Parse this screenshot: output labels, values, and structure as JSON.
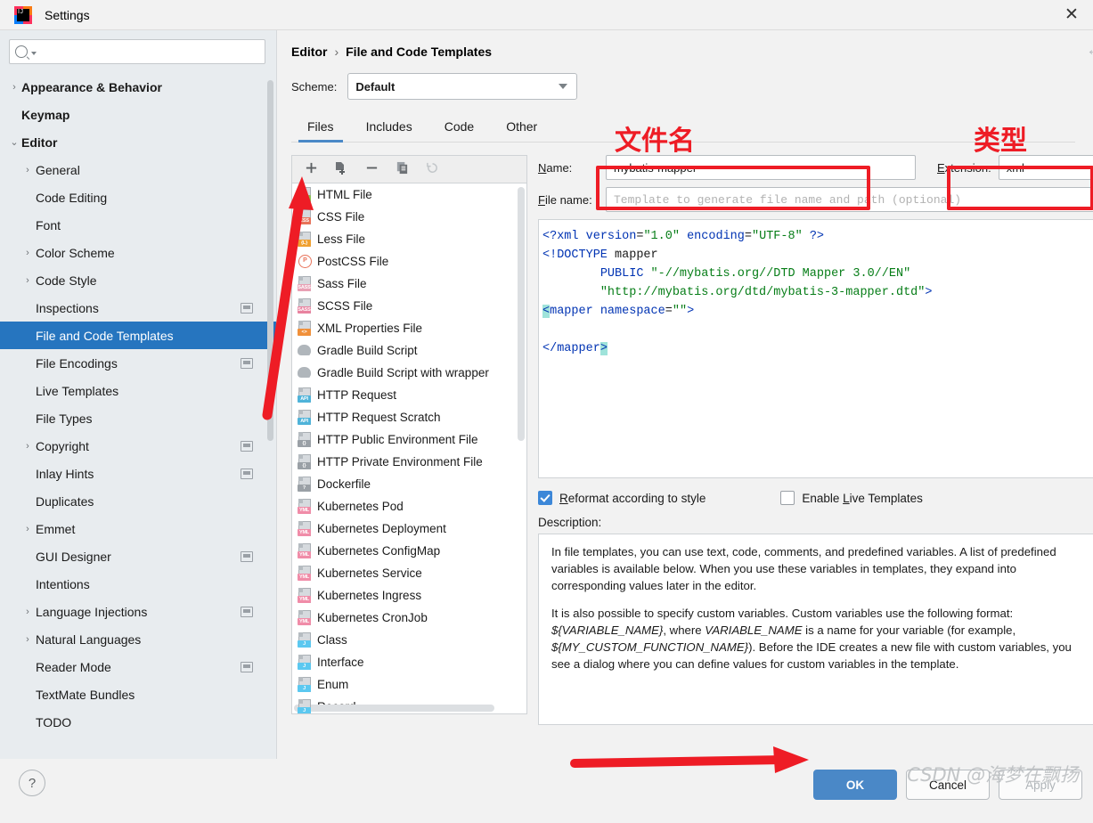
{
  "window": {
    "title": "Settings",
    "close_label": "✕",
    "logo": "intellij-idea-logo"
  },
  "search": {
    "value": "",
    "placeholder": ""
  },
  "sidebar": {
    "items": [
      {
        "label": "Appearance & Behavior",
        "level": 0,
        "arrow": "›",
        "badge": false,
        "selected": false
      },
      {
        "label": "Keymap",
        "level": 0,
        "arrow": "",
        "badge": false,
        "selected": false
      },
      {
        "label": "Editor",
        "level": 0,
        "arrow": "⌄",
        "badge": false,
        "selected": false
      },
      {
        "label": "General",
        "level": 1,
        "arrow": "›",
        "badge": false,
        "selected": false
      },
      {
        "label": "Code Editing",
        "level": 1,
        "arrow": "",
        "badge": false,
        "selected": false
      },
      {
        "label": "Font",
        "level": 1,
        "arrow": "",
        "badge": false,
        "selected": false
      },
      {
        "label": "Color Scheme",
        "level": 1,
        "arrow": "›",
        "badge": false,
        "selected": false
      },
      {
        "label": "Code Style",
        "level": 1,
        "arrow": "›",
        "badge": false,
        "selected": false
      },
      {
        "label": "Inspections",
        "level": 1,
        "arrow": "",
        "badge": true,
        "selected": false
      },
      {
        "label": "File and Code Templates",
        "level": 1,
        "arrow": "",
        "badge": false,
        "selected": true
      },
      {
        "label": "File Encodings",
        "level": 1,
        "arrow": "",
        "badge": true,
        "selected": false
      },
      {
        "label": "Live Templates",
        "level": 1,
        "arrow": "",
        "badge": false,
        "selected": false
      },
      {
        "label": "File Types",
        "level": 1,
        "arrow": "",
        "badge": false,
        "selected": false
      },
      {
        "label": "Copyright",
        "level": 1,
        "arrow": "›",
        "badge": true,
        "selected": false
      },
      {
        "label": "Inlay Hints",
        "level": 1,
        "arrow": "",
        "badge": true,
        "selected": false
      },
      {
        "label": "Duplicates",
        "level": 1,
        "arrow": "",
        "badge": false,
        "selected": false
      },
      {
        "label": "Emmet",
        "level": 1,
        "arrow": "›",
        "badge": false,
        "selected": false
      },
      {
        "label": "GUI Designer",
        "level": 1,
        "arrow": "",
        "badge": true,
        "selected": false
      },
      {
        "label": "Intentions",
        "level": 1,
        "arrow": "",
        "badge": false,
        "selected": false
      },
      {
        "label": "Language Injections",
        "level": 1,
        "arrow": "›",
        "badge": true,
        "selected": false
      },
      {
        "label": "Natural Languages",
        "level": 1,
        "arrow": "›",
        "badge": false,
        "selected": false
      },
      {
        "label": "Reader Mode",
        "level": 1,
        "arrow": "",
        "badge": true,
        "selected": false
      },
      {
        "label": "TextMate Bundles",
        "level": 1,
        "arrow": "",
        "badge": false,
        "selected": false
      },
      {
        "label": "TODO",
        "level": 1,
        "arrow": "",
        "badge": false,
        "selected": false
      }
    ]
  },
  "breadcrumb": {
    "parent": "Editor",
    "separator": "›",
    "current": "File and Code Templates"
  },
  "nav": {
    "back": "←",
    "forward": "→"
  },
  "scheme": {
    "label": "Scheme:",
    "value": "Default"
  },
  "tabs": [
    {
      "label": "Files",
      "active": true
    },
    {
      "label": "Includes",
      "active": false
    },
    {
      "label": "Code",
      "active": false
    },
    {
      "label": "Other",
      "active": false
    }
  ],
  "list_toolbar": [
    {
      "name": "add-template-button",
      "glyph": "+",
      "disabled": false
    },
    {
      "name": "create-template-from-file-button",
      "glyph": "",
      "disabled": false
    },
    {
      "name": "remove-template-button",
      "glyph": "−",
      "disabled": false
    },
    {
      "name": "copy-template-button",
      "glyph": "",
      "disabled": false
    },
    {
      "name": "reset-template-button",
      "glyph": "↺",
      "disabled": true
    }
  ],
  "templates": [
    {
      "label": "HTML File",
      "icon": "html-file-icon",
      "tag": "",
      "tagcolor": "#8cc152",
      "blob": "#8cc152"
    },
    {
      "label": "CSS File",
      "icon": "css-file-icon",
      "tag": "CSS",
      "tagcolor": "#e8735a",
      "blob": ""
    },
    {
      "label": "Less File",
      "icon": "less-file-icon",
      "tag": "{L}",
      "tagcolor": "#f0a030",
      "blob": ""
    },
    {
      "label": "PostCSS File",
      "icon": "postcss-file-icon",
      "tag": "",
      "tagcolor": "",
      "blob": ""
    },
    {
      "label": "Sass File",
      "icon": "sass-file-icon",
      "tag": "SASS",
      "tagcolor": "#e8a0b4",
      "blob": ""
    },
    {
      "label": "SCSS File",
      "icon": "scss-file-icon",
      "tag": "SASS",
      "tagcolor": "#e8829f",
      "blob": ""
    },
    {
      "label": "XML Properties File",
      "icon": "xml-properties-file-icon",
      "tag": "<>",
      "tagcolor": "#f0903a",
      "blob": ""
    },
    {
      "label": "Gradle Build Script",
      "icon": "gradle-file-icon",
      "tag": "",
      "tagcolor": "",
      "blob": ""
    },
    {
      "label": "Gradle Build Script with wrapper",
      "icon": "gradle-wrapper-file-icon",
      "tag": "",
      "tagcolor": "",
      "blob": ""
    },
    {
      "label": "HTTP Request",
      "icon": "http-request-file-icon",
      "tag": "API",
      "tagcolor": "#4fb3d9",
      "blob": ""
    },
    {
      "label": "HTTP Request Scratch",
      "icon": "http-request-scratch-icon",
      "tag": "API",
      "tagcolor": "#4fb3d9",
      "blob": ""
    },
    {
      "label": "HTTP Public Environment File",
      "icon": "http-public-env-file-icon",
      "tag": "{}",
      "tagcolor": "#9aa0a6",
      "blob": ""
    },
    {
      "label": "HTTP Private Environment File",
      "icon": "http-private-env-file-icon",
      "tag": "{}",
      "tagcolor": "#9aa0a6",
      "blob": ""
    },
    {
      "label": "Dockerfile",
      "icon": "dockerfile-icon",
      "tag": "?",
      "tagcolor": "#9aa0a6",
      "blob": ""
    },
    {
      "label": "Kubernetes Pod",
      "icon": "kubernetes-pod-icon",
      "tag": "YML",
      "tagcolor": "#f08ca8",
      "blob": ""
    },
    {
      "label": "Kubernetes Deployment",
      "icon": "kubernetes-deployment-icon",
      "tag": "YML",
      "tagcolor": "#f08ca8",
      "blob": ""
    },
    {
      "label": "Kubernetes ConfigMap",
      "icon": "kubernetes-configmap-icon",
      "tag": "YML",
      "tagcolor": "#f08ca8",
      "blob": ""
    },
    {
      "label": "Kubernetes Service",
      "icon": "kubernetes-service-icon",
      "tag": "YML",
      "tagcolor": "#f08ca8",
      "blob": ""
    },
    {
      "label": "Kubernetes Ingress",
      "icon": "kubernetes-ingress-icon",
      "tag": "YML",
      "tagcolor": "#f08ca8",
      "blob": ""
    },
    {
      "label": "Kubernetes CronJob",
      "icon": "kubernetes-cronjob-icon",
      "tag": "YML",
      "tagcolor": "#f08ca8",
      "blob": ""
    },
    {
      "label": "Class",
      "icon": "java-class-icon",
      "tag": "J",
      "tagcolor": "#5bc8f0",
      "blob": ""
    },
    {
      "label": "Interface",
      "icon": "java-interface-icon",
      "tag": "J",
      "tagcolor": "#5bc8f0",
      "blob": ""
    },
    {
      "label": "Enum",
      "icon": "java-enum-icon",
      "tag": "J",
      "tagcolor": "#5bc8f0",
      "blob": ""
    },
    {
      "label": "Record",
      "icon": "java-record-icon",
      "tag": "J",
      "tagcolor": "#5bc8f0",
      "blob": ""
    }
  ],
  "form": {
    "name_label": "Name:",
    "name_value": "mybatis-mapper",
    "extension_label": "Extension:",
    "extension_value": "xml",
    "filename_label": "File name:",
    "filename_value": "",
    "filename_placeholder": "Template to generate file name and path (optional)"
  },
  "editor": {
    "lines": [
      "<?xml version=\"1.0\" encoding=\"UTF-8\" ?>",
      "<!DOCTYPE mapper",
      "        PUBLIC \"-//mybatis.org//DTD Mapper 3.0//EN\"",
      "        \"http://mybatis.org/dtd/mybatis-3-mapper.dtd\">",
      "<mapper namespace=\"\">",
      "",
      "</mapper>"
    ]
  },
  "options": {
    "reformat_label": "Reformat according to style",
    "reformat_checked": true,
    "live_templates_label": "Enable Live Templates",
    "live_templates_checked": false
  },
  "description": {
    "label": "Description:",
    "paragraph1": "In file templates, you can use text, code, comments, and predefined variables. A list of predefined variables is available below. When you use these variables in templates, they expand into corresponding values later in the editor.",
    "paragraph2_a": "It is also possible to specify custom variables. Custom variables use the following format: ",
    "paragraph2_var1": "${VARIABLE_NAME}",
    "paragraph2_b": ", where ",
    "paragraph2_var2": "VARIABLE_NAME",
    "paragraph2_c": " is a name for your variable (for example, ",
    "paragraph2_var3": "${MY_CUSTOM_FUNCTION_NAME}",
    "paragraph2_d": "). Before the IDE creates a new file with custom variables, you see a dialog where you can define values for custom variables in the template."
  },
  "footer": {
    "help_label": "?",
    "ok_label": "OK",
    "cancel_label": "Cancel",
    "apply_label": "Apply"
  },
  "annotations": {
    "filename_cn": "文件名",
    "type_cn": "类型",
    "accent_red": "#ee1c25"
  },
  "watermark": "CSDN @海梦在飘扬"
}
